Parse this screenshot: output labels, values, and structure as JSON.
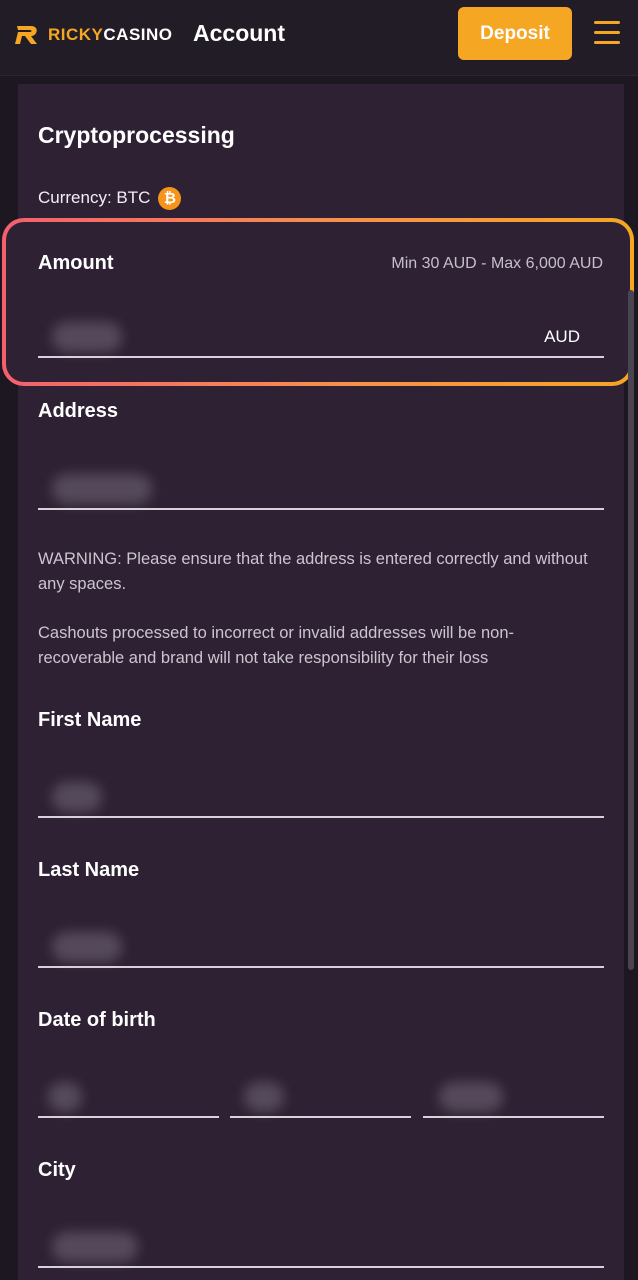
{
  "header": {
    "logo_part1": "RICKY",
    "logo_part2": "CASINO",
    "title": "Account",
    "deposit_label": "Deposit"
  },
  "form": {
    "title": "Cryptoprocessing",
    "currency_label": "Currency: BTC",
    "currency_icon": "bitcoin-icon",
    "amount": {
      "label": "Amount",
      "hint": "Min 30 AUD - Max 6,000 AUD",
      "suffix": "AUD"
    },
    "address": {
      "label": "Address"
    },
    "warning": "WARNING: Please ensure that the address is entered correctly and without any spaces.",
    "disclaimer": "Cashouts processed to incorrect or invalid addresses will be non-recoverable and brand will not take responsibility for their loss",
    "first_name": {
      "label": "First Name"
    },
    "last_name": {
      "label": "Last Name"
    },
    "date_of_birth": {
      "label": "Date of birth"
    },
    "city": {
      "label": "City"
    }
  },
  "colors": {
    "accent": "#f5a623",
    "panel": "#2e2133",
    "background": "#1c1720",
    "highlight_start": "#f4606e",
    "highlight_end": "#f5a623"
  }
}
